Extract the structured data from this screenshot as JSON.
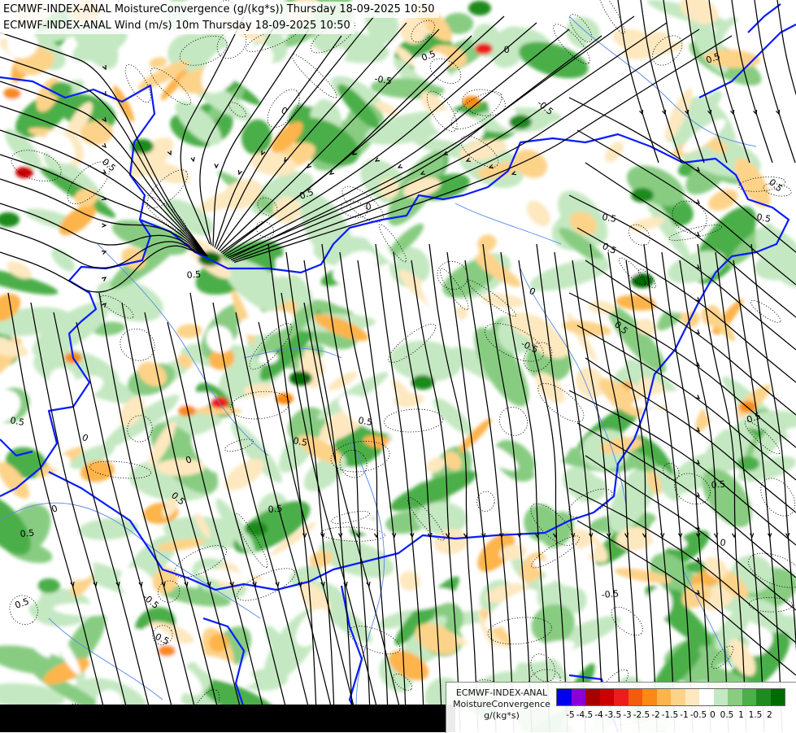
{
  "titles": {
    "line1": "ECMWF-INDEX-ANAL MoistureConvergence (g/(kg*s)) Thursday 18-09-2025 10:50",
    "line2": "ECMWF-INDEX-ANAL Wind (m/s) 10m Thursday 18-09-2025 10:50"
  },
  "legend": {
    "model": "ECMWF-INDEX-ANAL",
    "parameter": "MoistureConvergence",
    "unit": "g/(kg*s)",
    "ticks": [
      "-5",
      "-4.5",
      "-4",
      "-3.5",
      "-3",
      "-2.5",
      "-2",
      "-1.5",
      "-1",
      "-0.5",
      "0",
      "0.5",
      "1",
      "1.5",
      "2"
    ],
    "colors": [
      "#0000ee",
      "#8a00d8",
      "#a80000",
      "#cc0000",
      "#ee1c1c",
      "#f35b0e",
      "#f98a18",
      "#fdb44c",
      "#fdd38a",
      "#fde8bf",
      "#ffffff",
      "#c4e8c1",
      "#88cc82",
      "#4caf48",
      "#1f8b1f",
      "#006b00"
    ]
  },
  "contour_labels": [
    "0.5",
    "0",
    "-0.5",
    "0",
    "0.5",
    "0.5",
    "0",
    "0.5",
    "0.5",
    "-0.5",
    "0.5",
    "0.5",
    "0.5",
    "0",
    "0.5",
    "0",
    "0.5",
    "0.5",
    "0.5",
    "-0.5",
    "0.5",
    "0.5",
    "0.5",
    "0",
    "0.5",
    "0.5",
    "0.5",
    "0",
    "-0.5",
    "0.5",
    "0",
    "-0.5",
    "0.5"
  ],
  "map_colors": {
    "border": "#0a1cff",
    "river": "#5a88e8",
    "streamline": "#000000",
    "contour": "#000000"
  }
}
